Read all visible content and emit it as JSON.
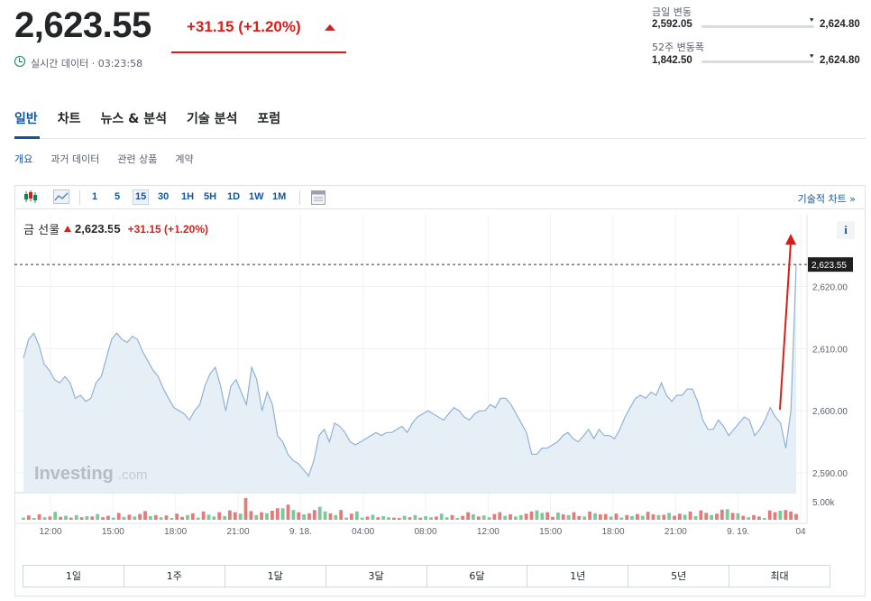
{
  "header": {
    "price": "2,623.55",
    "change": "+31.15 (+1.20%)",
    "realtime_label": "실시간 데이터 · 03:23:58"
  },
  "ranges": {
    "day_label": "금일 변동",
    "day_low": "2,592.05",
    "day_high": "2,624.80",
    "day_position": 0.99,
    "week52_label": "52주 변동폭",
    "week52_low": "1,842.50",
    "week52_high": "2,624.80",
    "week52_position": 0.99
  },
  "tabs": [
    "일반",
    "차트",
    "뉴스 & 분석",
    "기술 분석",
    "포럼"
  ],
  "active_tab": "일반",
  "subtabs": [
    "개요",
    "과거 데이터",
    "관련 상품",
    "계약"
  ],
  "active_subtab": "개요",
  "toolbar": {
    "icons": [
      "candlestick-icon",
      "area-chart-icon",
      "calendar-icon"
    ],
    "intervals": [
      "1",
      "5",
      "15",
      "30",
      "1H",
      "5H",
      "1D",
      "1W",
      "1M"
    ],
    "selected_interval": "15",
    "tech_chart_link": "기술적 차트 »"
  },
  "legend": {
    "name": "금 선물",
    "price": "2,623.55",
    "change": "+31.15 (+1.20%)",
    "info_label": "i"
  },
  "watermark": {
    "brand": "Investing",
    "suffix": ".com"
  },
  "periods": [
    "1일",
    "1주",
    "1달",
    "3달",
    "6달",
    "1년",
    "5년",
    "최대"
  ],
  "colors": {
    "up": "#d91e18",
    "link": "#1256a0",
    "line": "#8fb2d6",
    "area": "#e3ecf5",
    "vol_up": "#7ac99a",
    "vol_down": "#e57a7a",
    "realtime_green": "#0a8a4f"
  },
  "chart_data": {
    "type": "area",
    "series": [
      {
        "values": [
          2608.5,
          2611.5,
          2612.5,
          2610.5,
          2607.5,
          2606.5,
          2605,
          2604.5,
          2605.5,
          2604.5,
          2602,
          2602.5,
          2601.5,
          2602,
          2604.5,
          2605.5,
          2608.5,
          2611.5,
          2612.5,
          2611.5,
          2611,
          2612,
          2611.5,
          2609.5,
          2608,
          2606.5,
          2605.5,
          2603.5,
          2602,
          2600.5,
          2600,
          2599.5,
          2598.5,
          2600,
          2601,
          2604,
          2606,
          2607,
          2604,
          2600,
          2604,
          2605,
          2603,
          2601,
          2607,
          2605,
          2600,
          2603,
          2601,
          2596,
          2595,
          2593,
          2592,
          2591.5,
          2590.5,
          2589.5,
          2592,
          2596,
          2597,
          2595,
          2598,
          2597.5,
          2596.5,
          2595,
          2594.5,
          2595,
          2595.5,
          2596,
          2596.5,
          2596,
          2596.5,
          2596.5,
          2597,
          2597.5,
          2596.5,
          2598,
          2599,
          2599.5,
          2600,
          2599.5,
          2599,
          2598.5,
          2599.5,
          2600.5,
          2600,
          2599,
          2598.5,
          2599.5,
          2600,
          2600,
          2601,
          2600.5,
          2602,
          2602,
          2601,
          2599.5,
          2598,
          2596.5,
          2593,
          2593,
          2594,
          2594,
          2594.5,
          2595,
          2596,
          2596.5,
          2595.5,
          2595,
          2596,
          2597,
          2595.5,
          2597,
          2596,
          2596,
          2595.5,
          2597,
          2599,
          2600.5,
          2602,
          2602.5,
          2602,
          2603,
          2602.5,
          2604.5,
          2602.5,
          2601.5,
          2602.5,
          2602.5,
          2603.5,
          2603.5,
          2601.5,
          2598.5,
          2597,
          2597,
          2598.5,
          2597.5,
          2596,
          2597,
          2598,
          2599,
          2598.5,
          2596,
          2597,
          2598.5,
          2600.5,
          2599,
          2598,
          2594,
          2600,
          2623.55
        ]
      }
    ],
    "x_tick_labels": [
      "12:00",
      "15:00",
      "18:00",
      "21:00",
      "9. 18.",
      "04:00",
      "08:00",
      "12:00",
      "15:00",
      "18:00",
      "21:00",
      "9. 19.",
      "04"
    ],
    "y_tick_labels": [
      "2,620.00",
      "2,610.00",
      "2,600.00",
      "2,590.00"
    ],
    "y_ticks": [
      2620,
      2610,
      2600,
      2590
    ],
    "ylim": [
      2586.8,
      2627.2
    ],
    "last_price_label": "2,623.55",
    "last_price": 2623.55,
    "volume_tick_label": "5.00k",
    "volume_tick": 5000,
    "volume_max": 7000,
    "volumes": [
      600,
      1200,
      500,
      1500,
      700,
      900,
      2200,
      800,
      1100,
      600,
      1300,
      700,
      1000,
      900,
      1600,
      700,
      1100,
      600,
      1900,
      800,
      1400,
      900,
      1600,
      2400,
      1000,
      1300,
      700,
      1200,
      500,
      1700,
      800,
      1300,
      1800,
      600,
      2300,
      1400,
      900,
      2100,
      1000,
      2600,
      2100,
      1700,
      6000,
      2400,
      1300,
      2100,
      1800,
      2500,
      3200,
      3200,
      4200,
      2700,
      2100,
      1500,
      1800,
      2700,
      3600,
      2300,
      1800,
      1300,
      2700,
      600,
      1700,
      2300,
      600,
      900,
      1400,
      700,
      1000,
      700,
      600,
      500,
      1100,
      700,
      1300,
      600,
      1000,
      700,
      900,
      1700,
      700,
      1300,
      500,
      1100,
      2100,
      1500,
      900,
      1200,
      700,
      1600,
      2100,
      1100,
      1500,
      900,
      1300,
      1700,
      2300,
      2600,
      1900,
      2100,
      800,
      2000,
      1500,
      1300,
      2100,
      1000,
      900,
      2300,
      1800,
      1500,
      1600,
      900,
      1700,
      600,
      1300,
      1000,
      1600,
      1100,
      2200,
      1500,
      1300,
      1400,
      1900,
      1100,
      1700,
      1400,
      2300,
      1000,
      2600,
      1900,
      1300,
      1700,
      2800,
      2900,
      1900,
      1800,
      1100,
      700,
      1300,
      900,
      500,
      2600,
      2100,
      2500,
      2700,
      2300,
      1600
    ],
    "volume_up": [
      true,
      false,
      true,
      false,
      true,
      false,
      true,
      false,
      true,
      false,
      true,
      false,
      true,
      false,
      true,
      false,
      false,
      true,
      false,
      true,
      false,
      true,
      false,
      false,
      true,
      false,
      true,
      false,
      true,
      false,
      false,
      true,
      false,
      true,
      false,
      true,
      true,
      false,
      true,
      false,
      false,
      true,
      false,
      false,
      true,
      false,
      true,
      false,
      false,
      true,
      false,
      true,
      false,
      true,
      false,
      false,
      true,
      true,
      false,
      true,
      false,
      true,
      false,
      true,
      true,
      false,
      true,
      false,
      true,
      true,
      false,
      false,
      true,
      false,
      true,
      false,
      true,
      true,
      false,
      true,
      true,
      false,
      true,
      false,
      false,
      true,
      false,
      true,
      true,
      false,
      false,
      true,
      false,
      true,
      true,
      false,
      false,
      true,
      true,
      false,
      false,
      true,
      false,
      true,
      false,
      false,
      true,
      false,
      true,
      false,
      false,
      true,
      false,
      true,
      false,
      true,
      false,
      true,
      false,
      false,
      true,
      false,
      true,
      false,
      false,
      true,
      false,
      true,
      false,
      false,
      true,
      false,
      false,
      true,
      false,
      true,
      false,
      true,
      false,
      false,
      true,
      false,
      false,
      true,
      false
    ]
  }
}
